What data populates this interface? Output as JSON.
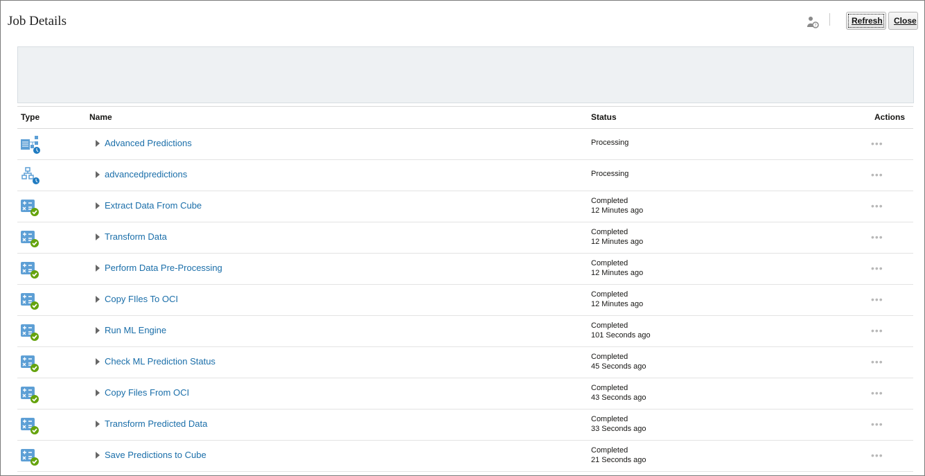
{
  "header": {
    "title": "Job Details",
    "refresh_label": "Refresh",
    "close_label": "Close"
  },
  "table": {
    "columns": {
      "type": "Type",
      "name": "Name",
      "status": "Status",
      "actions": "Actions"
    },
    "rows": [
      {
        "icon": "pipeline-scheduled-icon",
        "name": "Advanced Predictions",
        "status": "Processing",
        "time": ""
      },
      {
        "icon": "hierarchy-scheduled-icon",
        "name": "advancedpredictions",
        "status": "Processing",
        "time": ""
      },
      {
        "icon": "calculation-completed-icon",
        "name": "Extract Data From Cube",
        "status": "Completed",
        "time": "12 Minutes ago"
      },
      {
        "icon": "calculation-completed-icon",
        "name": "Transform Data",
        "status": "Completed",
        "time": "12 Minutes ago"
      },
      {
        "icon": "calculation-completed-icon",
        "name": "Perform Data Pre-Processing",
        "status": "Completed",
        "time": "12 Minutes ago"
      },
      {
        "icon": "calculation-completed-icon",
        "name": "Copy FIles To OCI",
        "status": "Completed",
        "time": "12 Minutes ago"
      },
      {
        "icon": "calculation-completed-icon",
        "name": "Run ML Engine",
        "status": "Completed",
        "time": "101 Seconds ago"
      },
      {
        "icon": "calculation-completed-icon",
        "name": "Check ML Prediction Status",
        "status": "Completed",
        "time": "45 Seconds ago"
      },
      {
        "icon": "calculation-completed-icon",
        "name": "Copy Files From OCI",
        "status": "Completed",
        "time": "43 Seconds ago"
      },
      {
        "icon": "calculation-completed-icon",
        "name": "Transform Predicted Data",
        "status": "Completed",
        "time": "33 Seconds ago"
      },
      {
        "icon": "calculation-completed-icon",
        "name": "Save Predictions to Cube",
        "status": "Completed",
        "time": "21 Seconds ago"
      }
    ],
    "actions_glyph": "•••"
  },
  "colors": {
    "link": "#1a6ea9",
    "icon_blue": "#5d9fd5",
    "badge_green": "#65a30d",
    "badge_blue": "#1f7bc1"
  }
}
